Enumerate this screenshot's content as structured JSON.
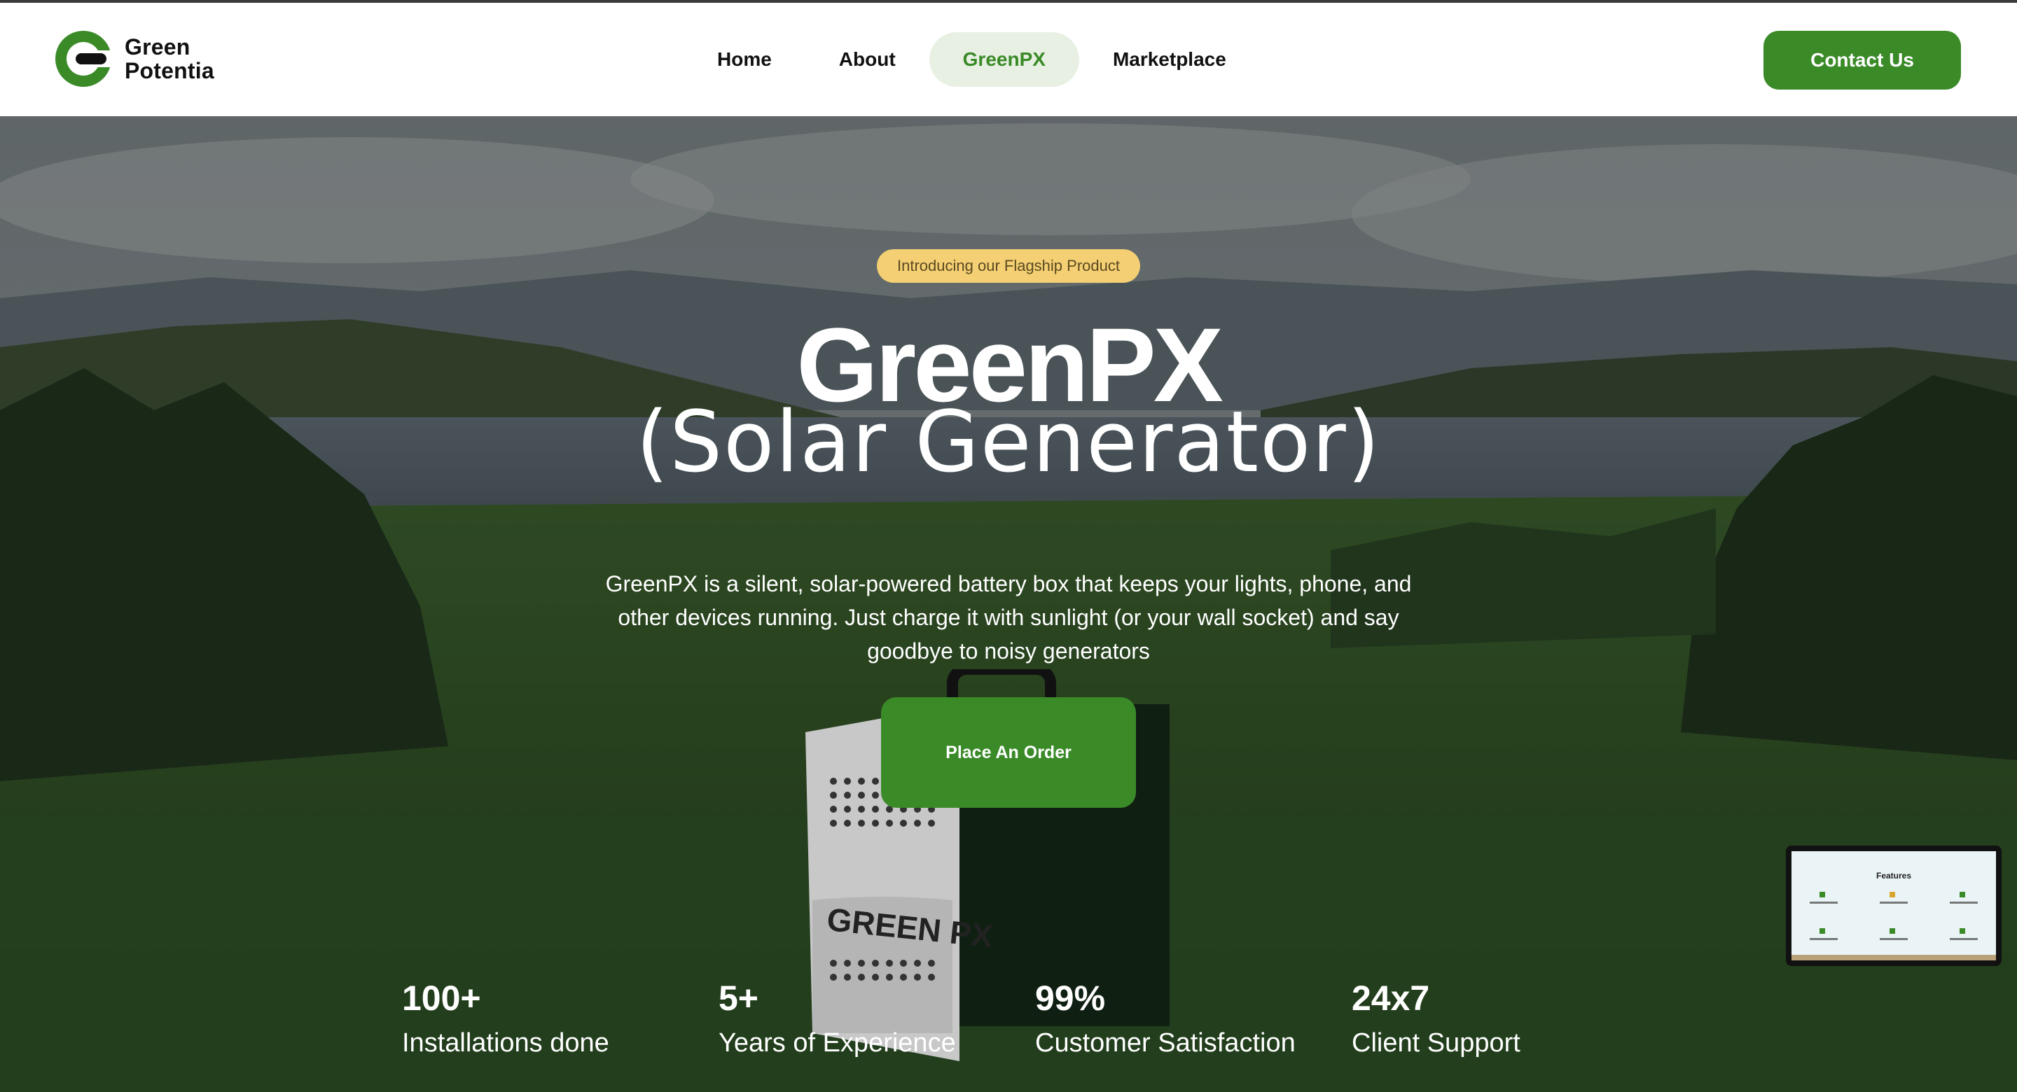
{
  "brand": {
    "line1": "Green",
    "line2": "Potentia",
    "accent": "#3a8a28"
  },
  "nav": {
    "items": [
      {
        "label": "Home"
      },
      {
        "label": "About"
      },
      {
        "label": "GreenPX",
        "active": true
      },
      {
        "label": "Marketplace"
      }
    ],
    "contact_label": "Contact Us"
  },
  "hero": {
    "badge": "Introducing our Flagship Product",
    "title": "GreenPX",
    "subtitle": "(Solar Generator)",
    "description": "GreenPX is a silent, solar-powered battery box that keeps your lights, phone, and other devices running. Just charge it with sunlight (or your wall socket) and say goodbye to noisy generators",
    "cta_label": "Place An Order",
    "product_label": "GREEN PX"
  },
  "stats": [
    {
      "value": "100+",
      "label": "Installations done"
    },
    {
      "value": "5+",
      "label": "Years of Experience"
    },
    {
      "value": "99%",
      "label": "Customer Satisfaction"
    },
    {
      "value": "24x7",
      "label": "Client Support"
    }
  ],
  "preview": {
    "title": "Features"
  },
  "colors": {
    "primary": "#3a8a28",
    "badge": "#f4cf73",
    "active_bg": "#e7f0e2"
  }
}
